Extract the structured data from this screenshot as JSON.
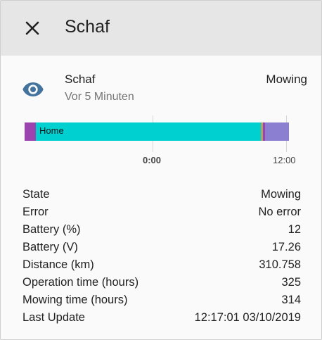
{
  "dialog": {
    "title": "Schaf"
  },
  "entity": {
    "name": "Schaf",
    "last_changed": "Vor 5 Minuten",
    "state": "Mowing",
    "icon": "eye-icon",
    "icon_color": "#44739e"
  },
  "timeline": {
    "segment_label": "Home",
    "tick_left": "0:00",
    "tick_right": "12:00",
    "colors": {
      "home": "#00d0d0",
      "edge": "#9b44b0",
      "end_a": "#b5a06a",
      "end_b": "#8a7fd0"
    }
  },
  "attributes": [
    {
      "key": "State",
      "value": "Mowing"
    },
    {
      "key": "Error",
      "value": "No error"
    },
    {
      "key": "Battery (%)",
      "value": "12"
    },
    {
      "key": "Battery (V)",
      "value": "17.26"
    },
    {
      "key": "Distance (km)",
      "value": "310.758"
    },
    {
      "key": "Operation time (hours)",
      "value": "325"
    },
    {
      "key": "Mowing time (hours)",
      "value": "314"
    },
    {
      "key": "Last Update",
      "value": "12:17:01 03/10/2019"
    }
  ]
}
